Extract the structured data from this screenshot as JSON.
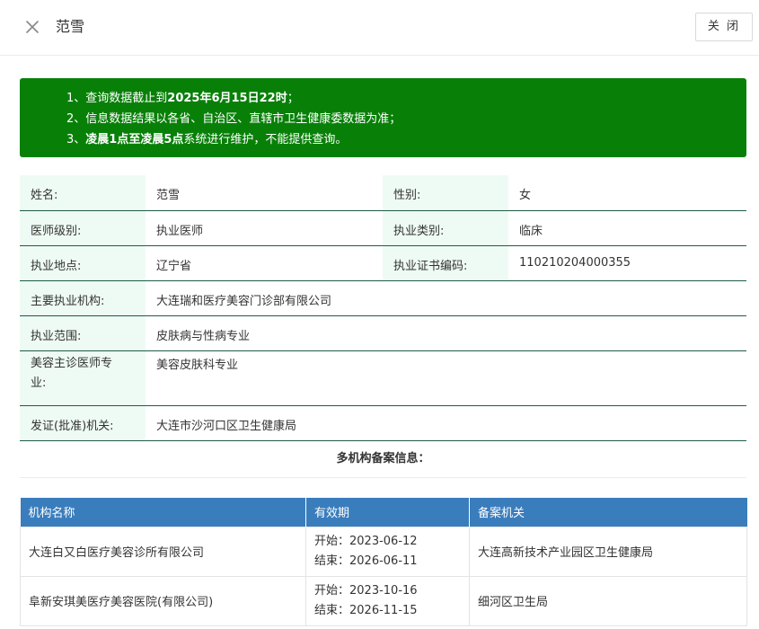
{
  "header": {
    "title": "范雪",
    "close_button": "关 闭",
    "close_icon": "close-icon"
  },
  "notice": {
    "lines": [
      {
        "pre": "1、查询数据截止到",
        "bold": "2025年6月15日22时",
        "post": "；"
      },
      {
        "pre": "2、信息数据结果以各省、自治区、直辖市卫生健康委数据为准；",
        "bold": "",
        "post": ""
      },
      {
        "pre": "3、",
        "bold": "凌晨1点至凌晨5点",
        "post": "系统进行维护，不能提供查询。"
      }
    ],
    "bg_color": "#088008"
  },
  "doctor": {
    "name_label": "姓名:",
    "name": "范雪",
    "gender_label": "性别:",
    "gender": "女",
    "level_label": "医师级别:",
    "level": "执业医师",
    "category_label": "执业类别:",
    "category": "临床",
    "location_label": "执业地点:",
    "location": "辽宁省",
    "cert_label": "执业证书编码:",
    "cert": "110210204000355",
    "org_label": "主要执业机构:",
    "org": "大连瑞和医疗美容门诊部有限公司",
    "scope_label": "执业范围:",
    "scope": "皮肤病与性病专业",
    "cosmetic_label_1": "美容主诊医师专",
    "cosmetic_label_2": "业:",
    "cosmetic": "美容皮肤科专业",
    "issuer_label": "发证(批准)机关:",
    "issuer": "大连市沙河口区卫生健康局"
  },
  "records_section": {
    "title": "多机构备案信息：",
    "columns": [
      "机构名称",
      "有效期",
      "备案机关"
    ],
    "header_color": "#3a7dbd",
    "rows": [
      {
        "org": "大连白又白医疗美容诊所有限公司",
        "start": "开始：2023-06-12",
        "end": "结束：2026-06-11",
        "authority": "大连高新技术产业园区卫生健康局"
      },
      {
        "org": "阜新安琪美医疗美容医院(有限公司)",
        "start": "开始：2023-10-16",
        "end": "结束：2026-11-15",
        "authority": "细河区卫生局"
      }
    ]
  }
}
